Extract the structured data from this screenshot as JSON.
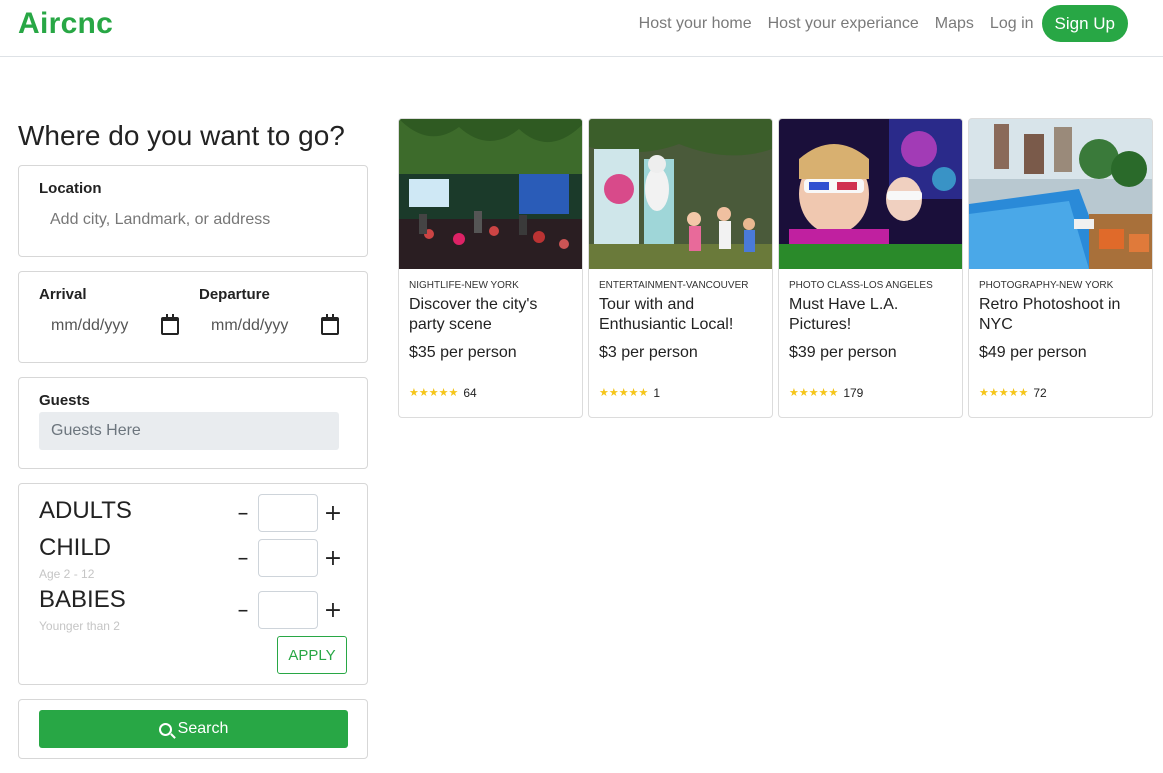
{
  "nav": {
    "brand": "Aircnc",
    "links": [
      "Host your home",
      "Host your experiance",
      "Maps",
      "Log in"
    ],
    "signup": "Sign Up"
  },
  "search_form": {
    "title": "Where do you want to go?",
    "location_label": "Location",
    "location_placeholder": "Add city, Landmark, or address",
    "arrival_label": "Arrival",
    "departure_label": "Departure",
    "date_placeholder": "mm/dd/yyy",
    "guests_label": "Guests",
    "guests_placeholder": "Guests Here",
    "counters": [
      {
        "label": "ADULTS",
        "sub": ""
      },
      {
        "label": "CHILD",
        "sub": "Age 2 - 12"
      },
      {
        "label": "BABIES",
        "sub": "Younger than 2"
      }
    ],
    "minus": "–",
    "plus": "+",
    "apply": "APPLY",
    "search": "Search"
  },
  "cards": [
    {
      "category": "NIGHTLIFE-NEW YORK",
      "title": "Discover the city's party scene",
      "price": "$35 per person",
      "rating": "★★★★★",
      "reviews": "64",
      "image": "nightlife-party-photo"
    },
    {
      "category": "ENTERTAINMENT-VANCOUVER",
      "title": "Tour with and Enthusiantic Local!",
      "price": "$3 per person",
      "rating": "★★★★★",
      "reviews": "1",
      "image": "entertainment-tour-photo"
    },
    {
      "category": "PHOTO CLASS-LOS ANGELES",
      "title": "Must Have L.A. Pictures!",
      "price": "$39 per person",
      "rating": "★★★★★",
      "reviews": "179",
      "image": "kids-3d-glasses-photo"
    },
    {
      "category": "PHOTOGRAPHY-NEW YORK",
      "title": "Retro Photoshoot in NYC",
      "price": "$49 per person",
      "rating": "★★★★★",
      "reviews": "72",
      "image": "rooftop-pool-photo"
    }
  ],
  "colors": {
    "brand": "#28a745",
    "star": "#f5c518"
  }
}
